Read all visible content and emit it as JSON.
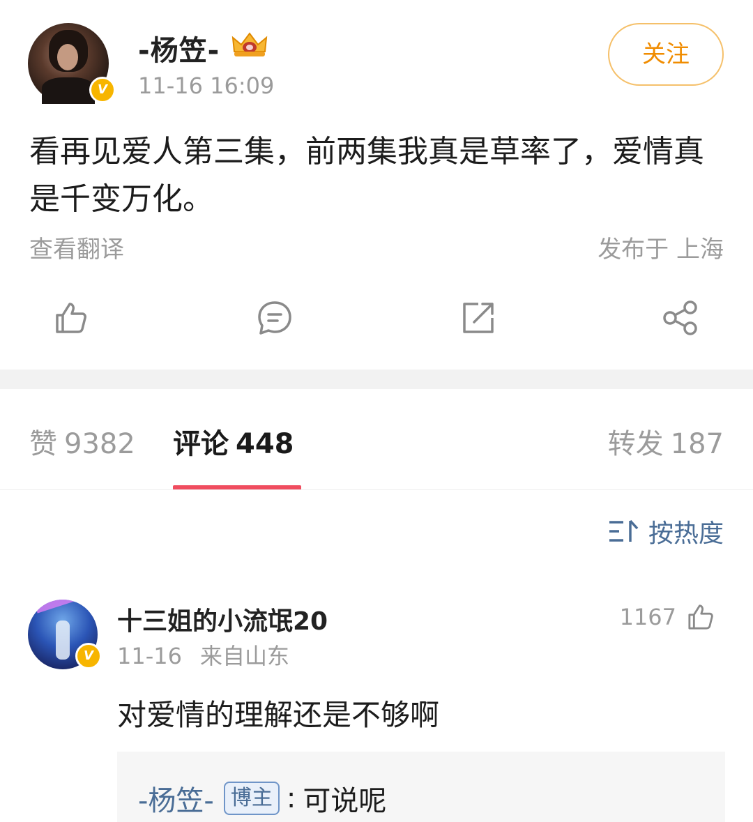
{
  "post": {
    "author": "-杨笠-",
    "time": "11-16 16:09",
    "follow_label": "关注",
    "content": "看再见爱人第三集，前两集我真是草率了，爱情真是千变万化。",
    "translate_label": "查看翻译",
    "location": "发布于 上海",
    "verified_label": "V",
    "icons": [
      "like-icon",
      "comment-icon",
      "repost-icon",
      "share-icon"
    ]
  },
  "tabs": {
    "likes_label": "赞",
    "likes_count": "9382",
    "comments_label": "评论",
    "comments_count": "448",
    "reposts_label": "转发",
    "reposts_count": "187"
  },
  "sort": {
    "label": "按热度"
  },
  "comment": {
    "name": "十三姐的小流氓20",
    "date": "11-16",
    "from": "来自山东",
    "likes": "1167",
    "text": "对爱情的理解还是不够啊",
    "verified_label": "V",
    "reply": {
      "author": "-杨笠-",
      "badge": "博主",
      "colon": ":",
      "text": "可说呢"
    }
  },
  "colors": {
    "accent_orange": "#f08c00",
    "tab_indicator": "#f04d5f",
    "link_blue": "#4a6d96",
    "verified_gold": "#f7b500"
  }
}
